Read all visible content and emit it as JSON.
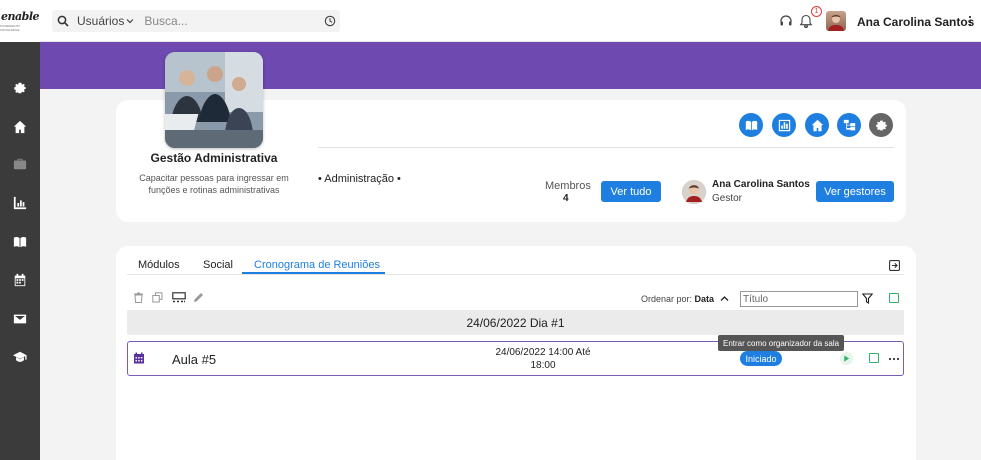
{
  "logo": {
    "text": "enable",
    "tagline": "POWERED BY KNOWLEDGE"
  },
  "search": {
    "scope": "Usuários",
    "placeholder": "Busca..."
  },
  "header": {
    "notification_count": "1",
    "user_name": "Ana Carolina Santos"
  },
  "course": {
    "title": "Gestão Administrativa",
    "description": "Capacitar pessoas para ingressar em funções e rotinas administrativas",
    "category": "• Administração •",
    "members_label": "Membros",
    "members_count": "4",
    "see_all_label": "Ver tudo",
    "manager_name": "Ana Carolina Santos",
    "manager_role": "Gestor",
    "see_managers_label": "Ver gestores"
  },
  "tabs": [
    {
      "label": "Módulos"
    },
    {
      "label": "Social"
    },
    {
      "label": "Cronograma de Reuniões"
    }
  ],
  "toolbar": {
    "sort_prefix": "Ordenar por:",
    "sort_value": "Data",
    "title_placeholder": "Título"
  },
  "schedule": {
    "date_header": "24/06/2022 Dia #1",
    "meetings": [
      {
        "title": "Aula #5",
        "time_line1": "24/06/2022 14:00 Até",
        "time_line2": "18:00",
        "status": "Iniciado",
        "tooltip": "Entrar como organizador da sala"
      }
    ]
  },
  "colors": {
    "accent": "#1e7fe0",
    "banner": "#6e4ab0",
    "sidebar": "#3b3b3b",
    "success": "#2fb36b"
  }
}
